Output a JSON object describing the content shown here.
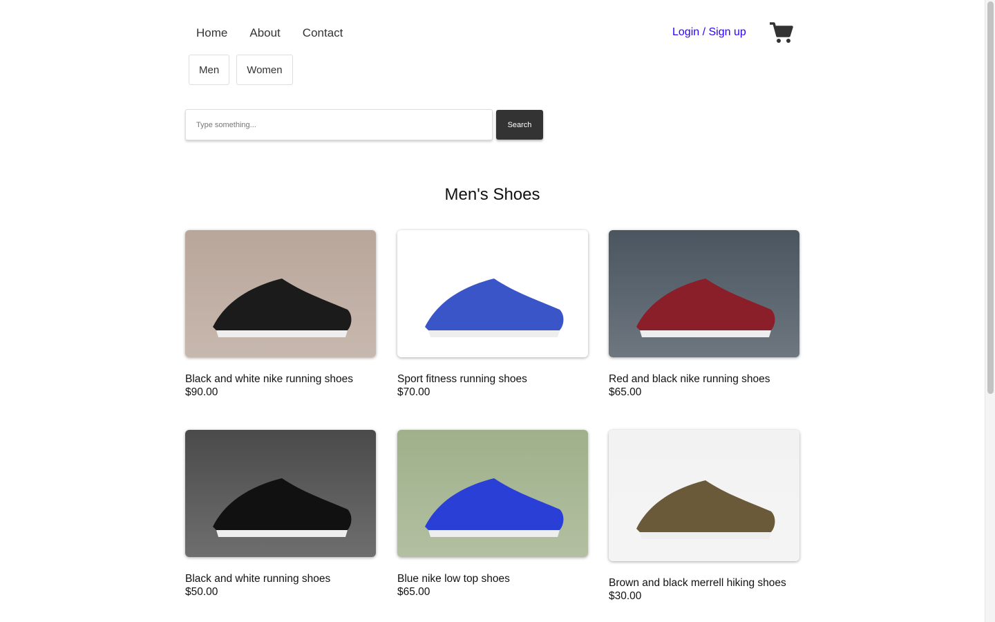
{
  "nav": {
    "items": [
      "Home",
      "About",
      "Contact"
    ],
    "login": "Login / Sign up",
    "link_color": "#2a00ff"
  },
  "categories": [
    "Men",
    "Women"
  ],
  "search": {
    "placeholder": "Type something...",
    "button": "Search"
  },
  "section_title": "Men's Shoes",
  "products": [
    {
      "name": "Black and white nike running shoes",
      "price": "$90.00",
      "bg": "#b9a69a",
      "shoe": "#1b1b1b"
    },
    {
      "name": "Sport fitness running shoes",
      "price": "$70.00",
      "bg": "#ffffff",
      "shoe": "#3a55c8"
    },
    {
      "name": "Red and black nike running shoes",
      "price": "$65.00",
      "bg": "#4a5560",
      "shoe": "#8a1f2a"
    },
    {
      "name": "Black and white running shoes",
      "price": "$50.00",
      "bg": "#4a4a4a",
      "shoe": "#111111"
    },
    {
      "name": "Blue nike low top shoes",
      "price": "$65.00",
      "bg": "#9fb08a",
      "shoe": "#2a3fd6"
    },
    {
      "name": "Brown and black merrell hiking shoes",
      "price": "$30.00",
      "bg": "#f2f2f2",
      "shoe": "#6b5a3a"
    }
  ]
}
